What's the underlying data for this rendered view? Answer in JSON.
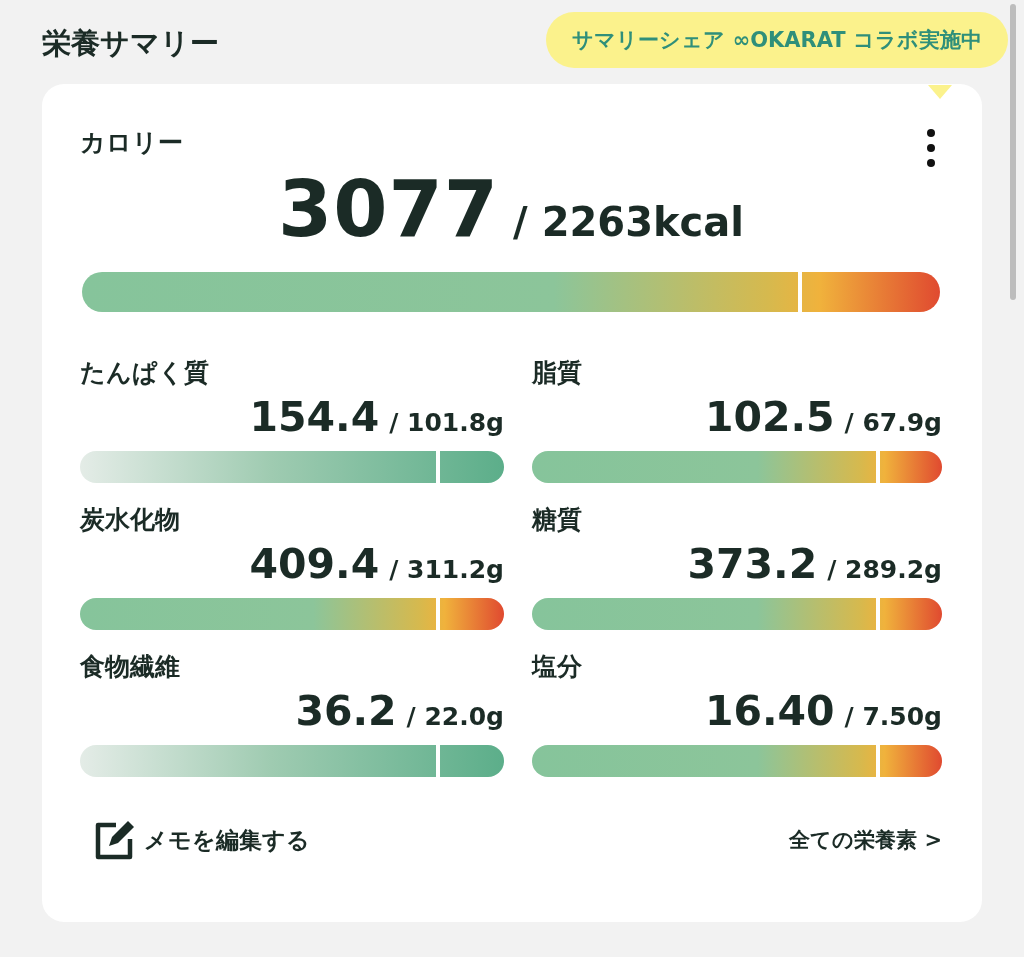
{
  "title": "栄養サマリー",
  "tooltip": "サマリーシェア ∞OKARAT コラボ実施中",
  "calorie": {
    "label": "カロリー",
    "value": "3077",
    "target": "/ 2263kcal",
    "kind": "limit",
    "level": 1
  },
  "nutrients": [
    {
      "label": "たんぱく質",
      "value": "154.4",
      "target": "/ 101.8g",
      "kind": "goal",
      "level": 1
    },
    {
      "label": "脂質",
      "value": "102.5",
      "target": "/ 67.9g",
      "kind": "limit",
      "level": 1
    },
    {
      "label": "炭水化物",
      "value": "409.4",
      "target": "/ 311.2g",
      "kind": "limit",
      "level": 1
    },
    {
      "label": "糖質",
      "value": "373.2",
      "target": "/ 289.2g",
      "kind": "limit",
      "level": 1
    },
    {
      "label": "食物繊維",
      "value": "36.2",
      "target": "/ 22.0g",
      "kind": "goal",
      "level": 1
    },
    {
      "label": "塩分",
      "value": "16.40",
      "target": "/ 7.50g",
      "kind": "limit",
      "level": 1
    }
  ],
  "memo_link": "メモを編集する",
  "all_link": "全ての栄養素 >"
}
